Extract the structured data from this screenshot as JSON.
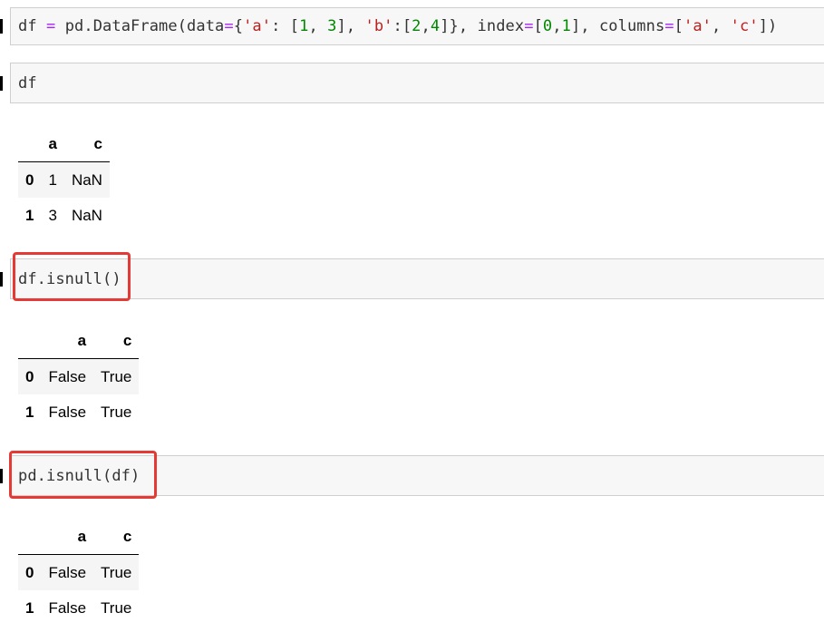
{
  "cells": [
    {
      "code_tokens": [
        {
          "t": "df ",
          "c": "txt"
        },
        {
          "t": "=",
          "c": "op"
        },
        {
          "t": " pd.DataFrame(data",
          "c": "txt"
        },
        {
          "t": "=",
          "c": "op"
        },
        {
          "t": "{",
          "c": "txt"
        },
        {
          "t": "'a'",
          "c": "str"
        },
        {
          "t": ": [",
          "c": "txt"
        },
        {
          "t": "1",
          "c": "num"
        },
        {
          "t": ", ",
          "c": "txt"
        },
        {
          "t": "3",
          "c": "num"
        },
        {
          "t": "], ",
          "c": "txt"
        },
        {
          "t": "'b'",
          "c": "str"
        },
        {
          "t": ":[",
          "c": "txt"
        },
        {
          "t": "2",
          "c": "num"
        },
        {
          "t": ",",
          "c": "txt"
        },
        {
          "t": "4",
          "c": "num"
        },
        {
          "t": "]}, index",
          "c": "txt"
        },
        {
          "t": "=",
          "c": "op"
        },
        {
          "t": "[",
          "c": "txt"
        },
        {
          "t": "0",
          "c": "num"
        },
        {
          "t": ",",
          "c": "txt"
        },
        {
          "t": "1",
          "c": "num"
        },
        {
          "t": "], columns",
          "c": "txt"
        },
        {
          "t": "=",
          "c": "op"
        },
        {
          "t": "[",
          "c": "txt"
        },
        {
          "t": "'a'",
          "c": "str"
        },
        {
          "t": ", ",
          "c": "txt"
        },
        {
          "t": "'c'",
          "c": "str"
        },
        {
          "t": "])",
          "c": "txt"
        }
      ]
    },
    {
      "code": "df",
      "output": {
        "columns": [
          "",
          "a",
          "c"
        ],
        "rows": [
          [
            "0",
            "1",
            "NaN"
          ],
          [
            "1",
            "3",
            "NaN"
          ]
        ]
      }
    },
    {
      "code": "df.isnull()",
      "output": {
        "columns": [
          "",
          "a",
          "c"
        ],
        "rows": [
          [
            "0",
            "False",
            "True"
          ],
          [
            "1",
            "False",
            "True"
          ]
        ]
      }
    },
    {
      "code": "pd.isnull(df)",
      "output": {
        "columns": [
          "",
          "a",
          "c"
        ],
        "rows": [
          [
            "0",
            "False",
            "True"
          ],
          [
            "1",
            "False",
            "True"
          ]
        ]
      }
    }
  ],
  "colors": {
    "highlight": "#e53935",
    "cell_bg": "#f7f7f7",
    "operator": "#aa22ff",
    "string": "#ba2121",
    "number": "#008800"
  }
}
